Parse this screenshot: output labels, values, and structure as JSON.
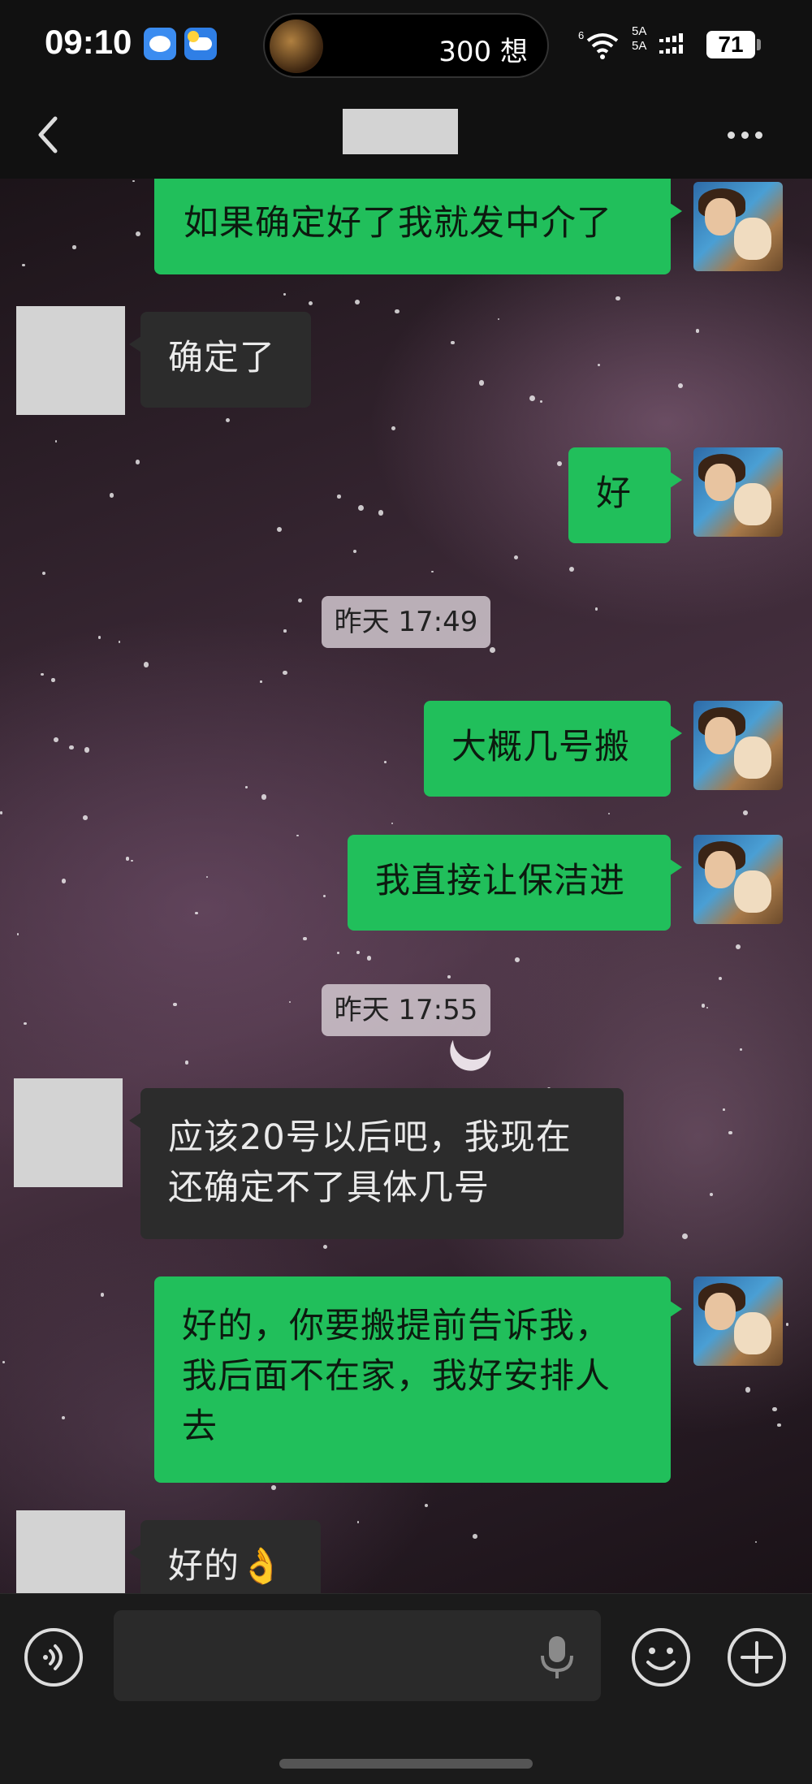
{
  "status_bar": {
    "time": "09:10",
    "notification_icons": [
      "message-icon",
      "weather-icon"
    ],
    "island_text": "300 想",
    "signal_label_top": "5A",
    "signal_label_bottom": "5A",
    "wifi_label": "6",
    "battery": "71"
  },
  "nav": {
    "back_icon": "chevron-left-icon",
    "more_icon": "more-horizontal-icon"
  },
  "messages": [
    {
      "side": "me",
      "text": "如果确定好了我就发中介了"
    },
    {
      "side": "other",
      "text": "确定了"
    },
    {
      "side": "me",
      "text": "好"
    },
    {
      "type": "time",
      "text": "昨天 17:49"
    },
    {
      "side": "me",
      "text": "大概几号搬"
    },
    {
      "side": "me",
      "text": "我直接让保洁进"
    },
    {
      "type": "time",
      "text": "昨天 17:55"
    },
    {
      "side": "other",
      "lines": [
        "应该20号以后吧，我现在",
        "还确定不了具体几号"
      ]
    },
    {
      "side": "me",
      "lines": [
        "好的，你要搬提前告诉我，",
        "我后面不在家，我好安排人",
        "去"
      ]
    },
    {
      "side": "other",
      "text": "好的",
      "emoji": "👌"
    }
  ],
  "input_bar": {
    "voice_icon": "voice-icon",
    "mic_icon": "mic-icon",
    "emoji_icon": "emoji-icon",
    "plus_icon": "plus-icon",
    "input_value": "",
    "input_placeholder": ""
  },
  "colors": {
    "my_bubble": "#21bf5b",
    "other_bubble": "#2c2c2c"
  }
}
